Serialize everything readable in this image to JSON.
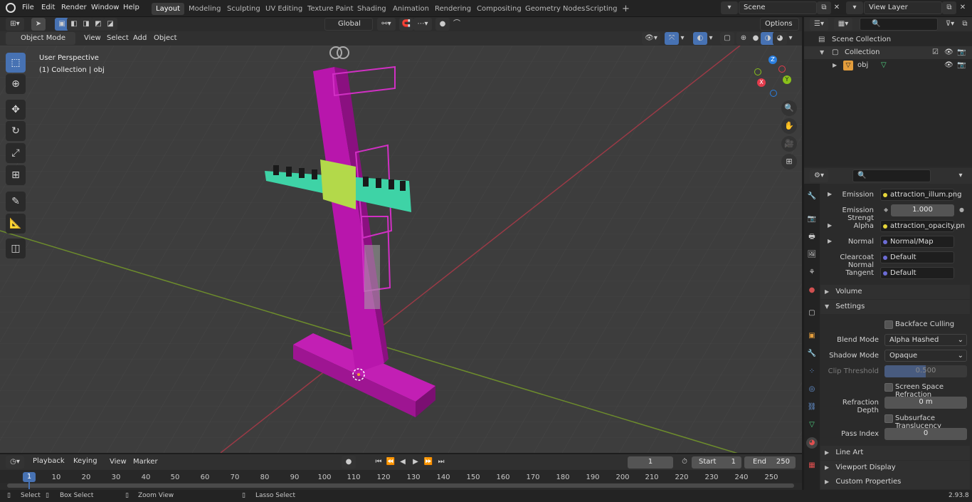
{
  "menus": [
    "File",
    "Edit",
    "Render",
    "Window",
    "Help"
  ],
  "workspaces": [
    "Layout",
    "Modeling",
    "Sculpting",
    "UV Editing",
    "Texture Paint",
    "Shading",
    "Animation",
    "Rendering",
    "Compositing",
    "Geometry Nodes",
    "Scripting"
  ],
  "active_workspace": "Layout",
  "scene": "Scene",
  "view_layer": "View Layer",
  "viewport_header": {
    "mode": "Object Mode",
    "menus": [
      "View",
      "Select",
      "Add",
      "Object"
    ],
    "orientation": "Global",
    "options": "Options"
  },
  "viewport": {
    "perspective": "User Perspective",
    "collection": "(1) Collection | obj",
    "gizmo_axes": {
      "z": "Z",
      "y": "Y",
      "x": "X"
    }
  },
  "outliner": {
    "scene_collection": "Scene Collection",
    "collection": "Collection",
    "object": "obj"
  },
  "properties": {
    "emission_label": "Emission",
    "emission_value": "attraction_illum.png",
    "emission_strength_label": "Emission Strengt",
    "emission_strength_value": "1.000",
    "alpha_label": "Alpha",
    "alpha_value": "attraction_opacity.pn",
    "normal_label": "Normal",
    "normal_value": "Normal/Map",
    "clearcoat_label": "Clearcoat Normal",
    "clearcoat_value": "Default",
    "tangent_label": "Tangent",
    "tangent_value": "Default",
    "volume": "Volume",
    "settings": "Settings",
    "backface_culling": "Backface Culling",
    "blend_mode_label": "Blend Mode",
    "blend_mode_value": "Alpha Hashed",
    "shadow_mode_label": "Shadow Mode",
    "shadow_mode_value": "Opaque",
    "clip_threshold_label": "Clip Threshold",
    "clip_threshold_value": "0.500",
    "screen_space_refraction": "Screen Space Refraction",
    "refraction_depth_label": "Refraction Depth",
    "refraction_depth_value": "0 m",
    "subsurface_translucency": "Subsurface Translucency",
    "pass_index_label": "Pass Index",
    "pass_index_value": "0",
    "line_art": "Line Art",
    "viewport_display": "Viewport Display",
    "custom_properties": "Custom Properties"
  },
  "timeline": {
    "menus": [
      "Playback",
      "Keying",
      "View",
      "Marker"
    ],
    "current_frame": "1",
    "start_label": "Start",
    "start_value": "1",
    "end_label": "End",
    "end_value": "250",
    "ruler": [
      "1",
      "10",
      "20",
      "30",
      "40",
      "50",
      "60",
      "70",
      "80",
      "90",
      "100",
      "110",
      "120",
      "130",
      "140",
      "150",
      "160",
      "170",
      "180",
      "190",
      "200",
      "210",
      "220",
      "230",
      "240",
      "250"
    ]
  },
  "status_bar": {
    "select": "Select",
    "box_select": "Box Select",
    "zoom_view": "Zoom View",
    "lasso_select": "Lasso Select",
    "version": "2.93.8"
  }
}
